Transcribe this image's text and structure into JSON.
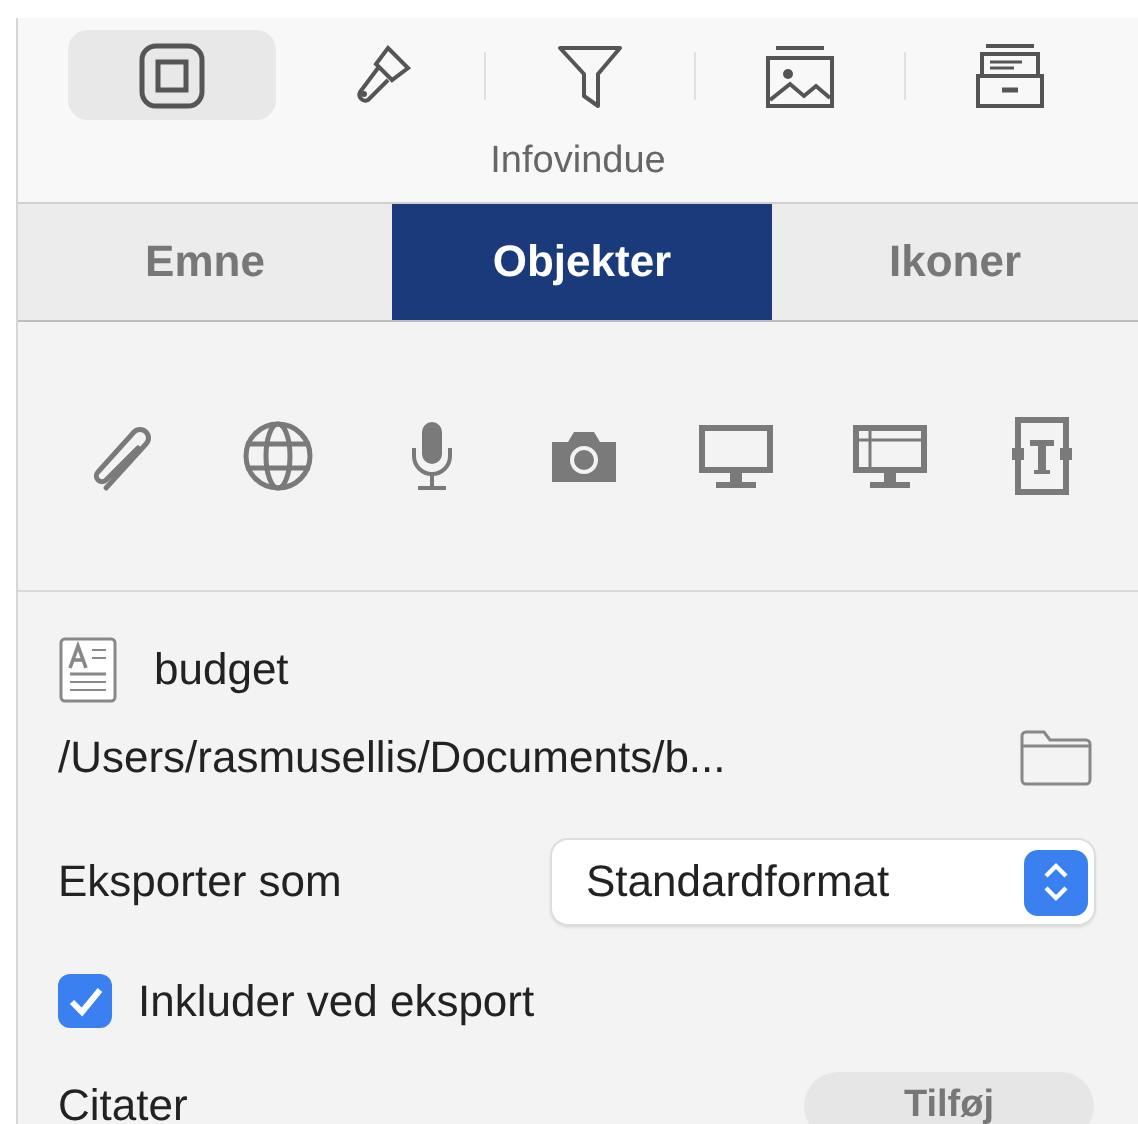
{
  "toolbar": {
    "items": [
      {
        "kind": "square",
        "selected": true
      },
      {
        "kind": "brush",
        "selected": false
      },
      {
        "kind": "filter",
        "selected": false
      },
      {
        "kind": "image",
        "selected": false
      },
      {
        "kind": "cabinet",
        "selected": false
      }
    ],
    "label": "Infovindue"
  },
  "tabs": [
    {
      "label": "Emne",
      "selected": false
    },
    {
      "label": "Objekter",
      "selected": true
    },
    {
      "label": "Ikoner",
      "selected": false
    }
  ],
  "object_buttons": [
    {
      "kind": "paperclip"
    },
    {
      "kind": "globe"
    },
    {
      "kind": "microphone"
    },
    {
      "kind": "camera"
    },
    {
      "kind": "monitor"
    },
    {
      "kind": "window"
    },
    {
      "kind": "textbox"
    }
  ],
  "file": {
    "name": "budget",
    "path": "/Users/rasmusellis/Documents/b..."
  },
  "export": {
    "label": "Eksporter som",
    "value": "Standardformat"
  },
  "include": {
    "label": "Inkluder ved eksport",
    "checked": true
  },
  "citations": {
    "label": "Citater",
    "button": "Tilføj"
  }
}
